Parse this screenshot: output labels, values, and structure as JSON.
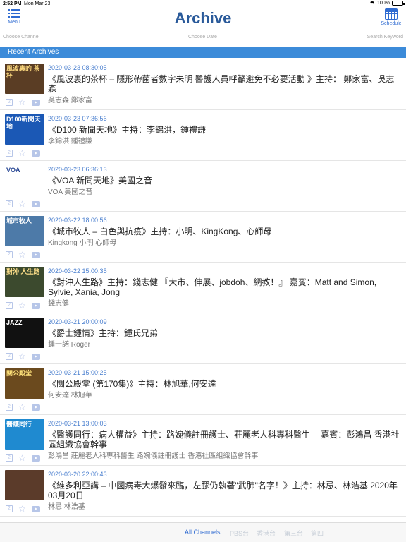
{
  "status": {
    "time": "2:52 PM",
    "date": "Mon Mar 23",
    "battery": "100%"
  },
  "nav": {
    "menu_label": "Menu",
    "title": "Archive",
    "schedule_label": "Schedule"
  },
  "filters": {
    "channel": "Choose Channel",
    "date": "Choose Date",
    "keyword": "Search Keyword"
  },
  "section_title": "Recent Archives",
  "rows": [
    {
      "datetime": "2020-03-23 08:30:05",
      "title": "《風波裏的茶杯 – 隱形帶菌者數字未明 醫護人員呼籲避免不必要活動 》主持： 鄭家富、吳志森",
      "hosts": "吳志森 鄭家富",
      "thumb_text": "風波裏的 茶杯",
      "thumb_bg": "#5a3d24",
      "thumb_fg": "#f5d27a",
      "num": "2"
    },
    {
      "datetime": "2020-03-23 07:36:56",
      "title": "《D100 新聞天地》主持：李錦洪，鍾禮謙",
      "hosts": "李錦洪 鍾禮謙",
      "thumb_text": "D100新聞天地",
      "thumb_bg": "#1b58b5",
      "thumb_fg": "#ffffff",
      "num": "2"
    },
    {
      "datetime": "2020-03-23 06:36:13",
      "title": "《VOA 新聞天地》美國之音",
      "hosts": "VOA 美國之音",
      "thumb_text": "VOA",
      "thumb_bg": "#ffffff",
      "thumb_fg": "#1f3f8f",
      "num": "2"
    },
    {
      "datetime": "2020-03-22 18:00:56",
      "title": "《城市牧人 – 白色與抗疫》主持：小明、KingKong、心師母",
      "hosts": "Kingkong 小明 心師母",
      "thumb_text": "城市牧人",
      "thumb_bg": "#4d7aa8",
      "thumb_fg": "#ffffff",
      "num": "2"
    },
    {
      "datetime": "2020-03-22 15:00:35",
      "title": "《對沖人生路》主持：錢志健 『大市、伸展、jobdoh、網教！』 嘉賓：Matt and Simon, Sylvie, Xania, Jong",
      "hosts": "錢志健",
      "thumb_text": "對沖 人生路",
      "thumb_bg": "#3c4a2e",
      "thumb_fg": "#ffe08a",
      "num": "2"
    },
    {
      "datetime": "2020-03-21 20:00:09",
      "title": "《爵士鍾情》主持：鍾氏兄弟",
      "hosts": "鍾一諾 Roger",
      "thumb_text": "JAZZ",
      "thumb_bg": "#111111",
      "thumb_fg": "#ffffff",
      "num": "2"
    },
    {
      "datetime": "2020-03-21 15:00:25",
      "title": "《關公殿堂 (第170集)》主持：林旭華,何安達",
      "hosts": "何安達 林旭華",
      "thumb_text": "關公殿堂",
      "thumb_bg": "#6b4a1e",
      "thumb_fg": "#ffe27a",
      "num": "2"
    },
    {
      "datetime": "2020-03-21 13:00:03",
      "title": "《醫護同行：病人權益》主持：路婉儀註冊護士、莊麗老人科專科醫生 　嘉賓：彭鴻昌 香港社區組織協會幹事",
      "hosts": "彭鴻昌 莊麗老人科專科醫生 路婉儀註冊護士 香港社區組織協會幹事",
      "thumb_text": "醫護同行",
      "thumb_bg": "#1f8ad0",
      "thumb_fg": "#ffffff",
      "num": "2"
    },
    {
      "datetime": "2020-03-20 22:00:43",
      "title": "《維多利亞講 – 中國病毒大爆發來臨，左膠仍執著\"武肺\"名字！》主持：林忌、林浩基 2020年03月20日",
      "hosts": "林忌 林浩基",
      "thumb_text": "",
      "thumb_bg": "#5b3b2a",
      "thumb_fg": "#ffffff",
      "num": "2"
    }
  ],
  "tabs": [
    "All Channels",
    "PBS台",
    "香港台",
    "第三台",
    "第四"
  ],
  "colors": {
    "accent": "#2f6bd1",
    "section_bg": "#3c8bd9",
    "datetime": "#4a7fcf"
  }
}
